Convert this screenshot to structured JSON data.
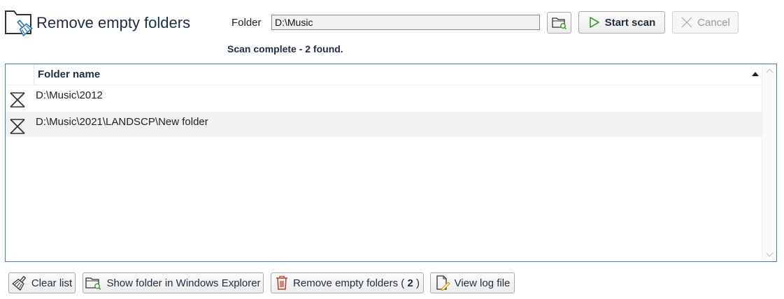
{
  "header": {
    "title": "Remove empty folders",
    "icon": "folder-broom-icon"
  },
  "folder": {
    "label": "Folder",
    "value": "D:\\Music"
  },
  "toolbar": {
    "start_scan_label": "Start scan",
    "cancel_label": "Cancel"
  },
  "status": {
    "text": "Scan complete - 2 found."
  },
  "list": {
    "column_header": "Folder name",
    "sort": "ascending",
    "rows": [
      {
        "path": "D:\\Music\\2012",
        "checked": true
      },
      {
        "path": "D:\\Music\\2021\\LANDSCP\\New folder",
        "checked": true
      }
    ]
  },
  "actions": {
    "clear_list": "Clear list",
    "show_in_explorer": "Show folder in Windows Explorer",
    "remove_prefix": "Remove empty folders ( ",
    "remove_count": "2",
    "remove_suffix": " )",
    "view_log": "View log file"
  },
  "colors": {
    "accent_blue": "#2e6fb4",
    "title_text": "#1f2d3d",
    "start_green": "#3a9a3a",
    "delete_red": "#c0392b",
    "list_border": "#4a7aa8"
  }
}
